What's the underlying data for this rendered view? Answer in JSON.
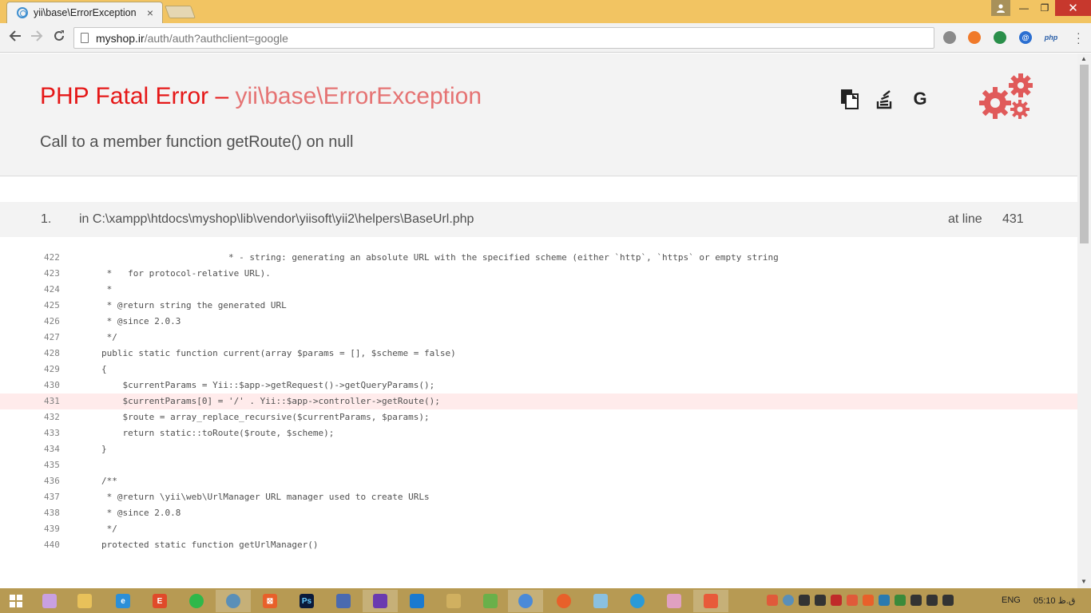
{
  "browser": {
    "tab_title": "yii\\base\\ErrorException",
    "tab_close": "×",
    "url_host": "myshop.ir",
    "url_path": "/auth/auth?authclient=google",
    "ext_php_label": "php"
  },
  "window": {
    "minimize": "—",
    "restore": "❐",
    "close": "✕"
  },
  "error": {
    "title_prefix": "PHP Fatal Error – ",
    "exception_class": "yii\\base\\ErrorException",
    "message": "Call to a member function getRoute() on null",
    "icon_google": "G"
  },
  "callstack": {
    "number": "1.",
    "file": "in C:\\xampp\\htdocs\\myshop\\lib\\vendor\\yiisoft\\yii2\\helpers\\BaseUrl.php",
    "at_label": "at line",
    "line": "431"
  },
  "code_lines": [
    {
      "n": "422",
      "text": "                        * - string: generating an absolute URL with the specified scheme (either `http`, `https` or empty string"
    },
    {
      "n": "423",
      "text": " *   for protocol-relative URL)."
    },
    {
      "n": "424",
      "text": " *"
    },
    {
      "n": "425",
      "text": " * @return string the generated URL"
    },
    {
      "n": "426",
      "text": " * @since 2.0.3"
    },
    {
      "n": "427",
      "text": " */"
    },
    {
      "n": "428",
      "text": "public static function current(array $params = [], $scheme = false)"
    },
    {
      "n": "429",
      "text": "{"
    },
    {
      "n": "430",
      "text": "    $currentParams = Yii::$app->getRequest()->getQueryParams();"
    },
    {
      "n": "431",
      "text": "    $currentParams[0] = '/' . Yii::$app->controller->getRoute();"
    },
    {
      "n": "432",
      "text": "    $route = array_replace_recursive($currentParams, $params);"
    },
    {
      "n": "433",
      "text": "    return static::toRoute($route, $scheme);"
    },
    {
      "n": "434",
      "text": "}"
    },
    {
      "n": "435",
      "text": ""
    },
    {
      "n": "436",
      "text": "/**"
    },
    {
      "n": "437",
      "text": " * @return \\yii\\web\\UrlManager URL manager used to create URLs"
    },
    {
      "n": "438",
      "text": " * @since 2.0.8"
    },
    {
      "n": "439",
      "text": " */"
    },
    {
      "n": "440",
      "text": "protected static function getUrlManager()"
    }
  ],
  "highlighted_line": "431",
  "taskbar": {
    "language": "ENG",
    "time": "05:10 ق.ظ"
  },
  "colors": {
    "error_red": "#e51717",
    "exception_pink": "#e57373",
    "gear_color": "#e05a5a",
    "highlight_bg": "#ffebeb",
    "titlebar": "#f2c462",
    "taskbar": "#b79a53"
  }
}
